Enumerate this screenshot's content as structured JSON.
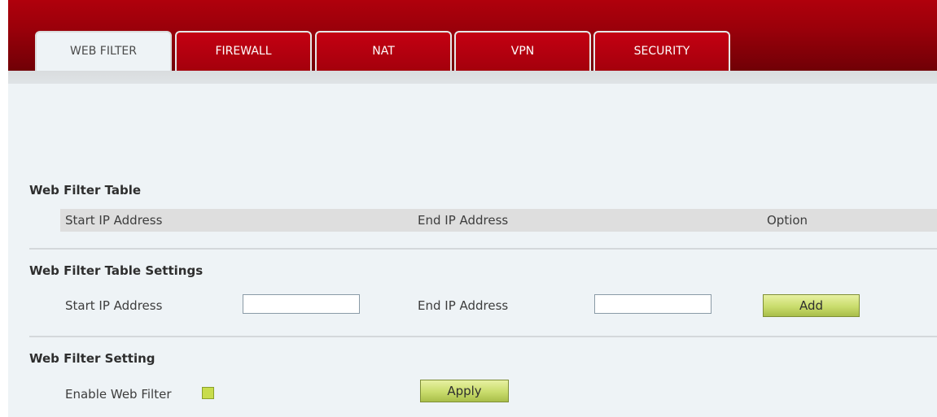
{
  "tabs": [
    {
      "label": "WEB FILTER",
      "active": true
    },
    {
      "label": "FIREWALL",
      "active": false
    },
    {
      "label": "NAT",
      "active": false
    },
    {
      "label": "VPN",
      "active": false
    },
    {
      "label": "SECURITY",
      "active": false
    }
  ],
  "web_filter_table": {
    "title": "Web Filter Table",
    "columns": [
      "Start IP Address",
      "End IP Address",
      "Option"
    ],
    "rows": []
  },
  "table_settings": {
    "title": "Web Filter Table Settings",
    "start_ip_label": "Start IP Address",
    "start_ip_value": "",
    "end_ip_label": "End IP Address",
    "end_ip_value": "",
    "add_label": "Add"
  },
  "filter_setting": {
    "title": "Web Filter Setting",
    "enable_label": "Enable Web Filter",
    "enabled": false,
    "apply_label": "Apply"
  },
  "colors": {
    "header_red": "#9a000a",
    "button_green": "#c9dc6c",
    "background": "#eef3f6"
  }
}
